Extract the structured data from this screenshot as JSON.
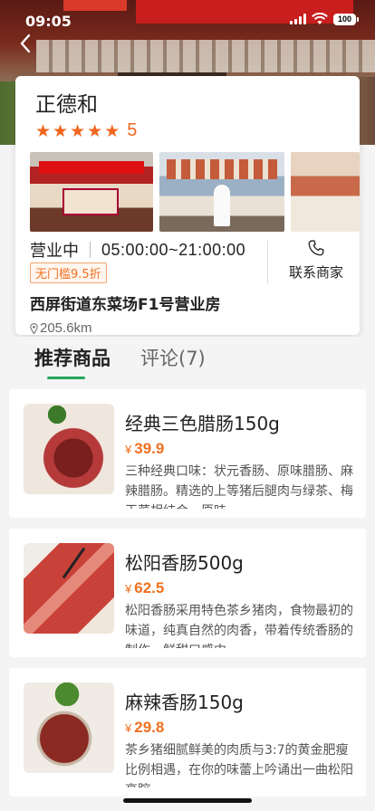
{
  "status_bar": {
    "time": "09:05",
    "battery": "100"
  },
  "store": {
    "name": "正德和",
    "rating": "5",
    "open_status": "营业中",
    "hours": "05:00:00~21:00:00",
    "promo": "无门槛9.5折",
    "contact_label": "联系商家",
    "address": "西屏街道东菜场F1号营业房",
    "distance": "205.6km"
  },
  "tabs": [
    {
      "label": "推荐商品",
      "active": true
    },
    {
      "label": "评论(7)",
      "active": false
    }
  ],
  "products": [
    {
      "title": "经典三色腊肠150g",
      "currency": "¥",
      "price": "39.9",
      "description": "三种经典口味：状元香肠、原味腊肠、麻辣腊肠。精选的上等猪后腿肉与绿茶、梅干菜相结合。原味"
    },
    {
      "title": "松阳香肠500g",
      "currency": "¥",
      "price": "62.5",
      "description": "松阳香肠采用特色茶乡猪肉，食物最初的味道，纯真自然的肉香，带着传统香肠的制作，鲜甜口感中"
    },
    {
      "title": "麻辣香肠150g",
      "currency": "¥",
      "price": "29.8",
      "description": "茶乡猪细腻鲜美的肉质与3:7的黄金肥瘦比例相遇，在你的味蕾上吟诵出一曲松阳高腔"
    }
  ],
  "colors": {
    "accent_orange": "#f0651e",
    "tab_indicator": "#26a65b"
  }
}
